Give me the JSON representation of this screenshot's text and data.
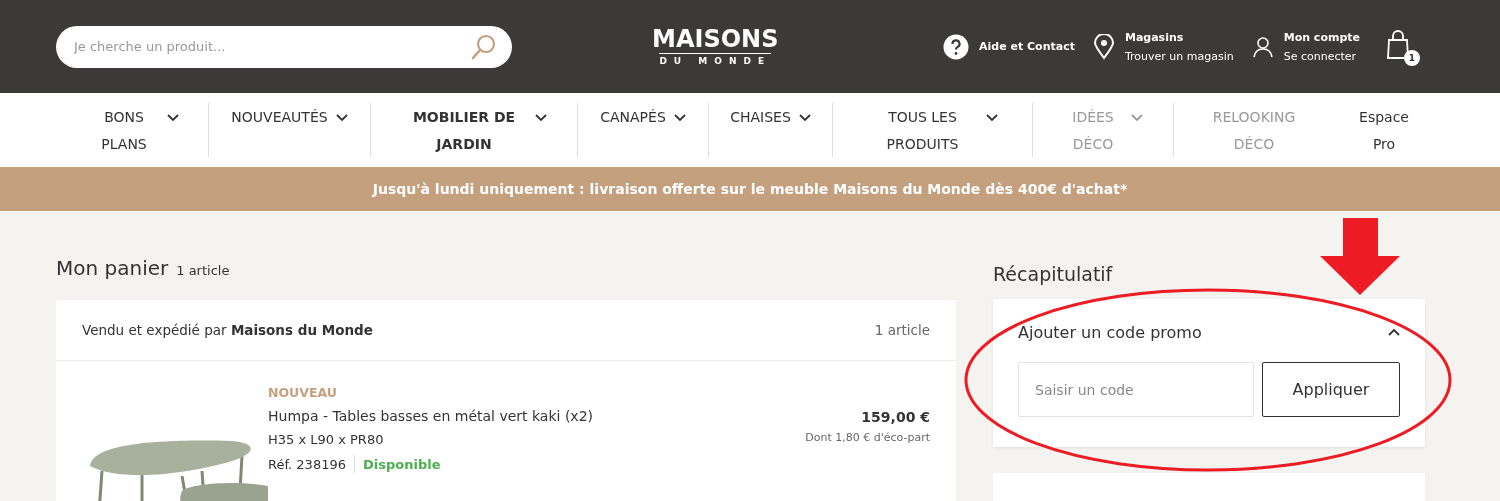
{
  "header": {
    "search": {
      "placeholder": "Je cherche un produit..."
    },
    "logo": {
      "line1": "MAISONS",
      "line2": "DU MONDE"
    },
    "help": {
      "label": "Aide et Contact"
    },
    "stores": {
      "title": "Magasins",
      "subtitle": "Trouver un magasin"
    },
    "account": {
      "title": "Mon compte",
      "subtitle": "Se connecter"
    },
    "cart": {
      "count": "1"
    }
  },
  "nav": [
    {
      "label": "BONS PLANS",
      "dropdown": true,
      "muted": false,
      "bold": false
    },
    {
      "label": "NOUVEAUTÉS",
      "dropdown": true,
      "muted": false,
      "bold": false
    },
    {
      "label": "MOBILIER DE JARDIN",
      "dropdown": true,
      "muted": false,
      "bold": true
    },
    {
      "label": "CANAPÉS",
      "dropdown": true,
      "muted": false,
      "bold": false
    },
    {
      "label": "CHAISES",
      "dropdown": true,
      "muted": false,
      "bold": false
    },
    {
      "label": "TOUS LES PRODUITS",
      "dropdown": true,
      "muted": false,
      "bold": false
    },
    {
      "label": "IDÉES DÉCO",
      "dropdown": true,
      "muted": true,
      "bold": false
    },
    {
      "label": "RELOOKING DÉCO",
      "dropdown": false,
      "muted": true,
      "bold": false
    },
    {
      "label": "Espace Pro",
      "dropdown": false,
      "muted": false,
      "bold": false
    }
  ],
  "banner": "Jusqu'à lundi uniquement : livraison offerte sur le meuble Maisons du Monde dès 400€ d'achat*",
  "cart": {
    "title": "Mon panier",
    "count": "1 article",
    "seller": {
      "text": "Vendu et expédié par **Maisons du Monde**",
      "count": "1 article"
    },
    "items": [
      {
        "badge": "NOUVEAU",
        "name": "Humpa - Tables basses en métal vert kaki (x2)",
        "dimensions": "H35 x L90 x PR80",
        "ref": "Réf. 238196",
        "availability": "Disponible",
        "price": "159,00 €",
        "eco_part": "Dont 1,80 € d'éco-part"
      }
    ]
  },
  "summary": {
    "title": "Récapitulatif",
    "promo": {
      "title": "Ajouter un code promo",
      "expanded": true,
      "placeholder": "Saisir un code",
      "button": "Appliquer"
    }
  },
  "annotations": {
    "arrow": {
      "color": "#ed1c24"
    },
    "ellipse": {
      "color": "#ed1c24"
    }
  }
}
